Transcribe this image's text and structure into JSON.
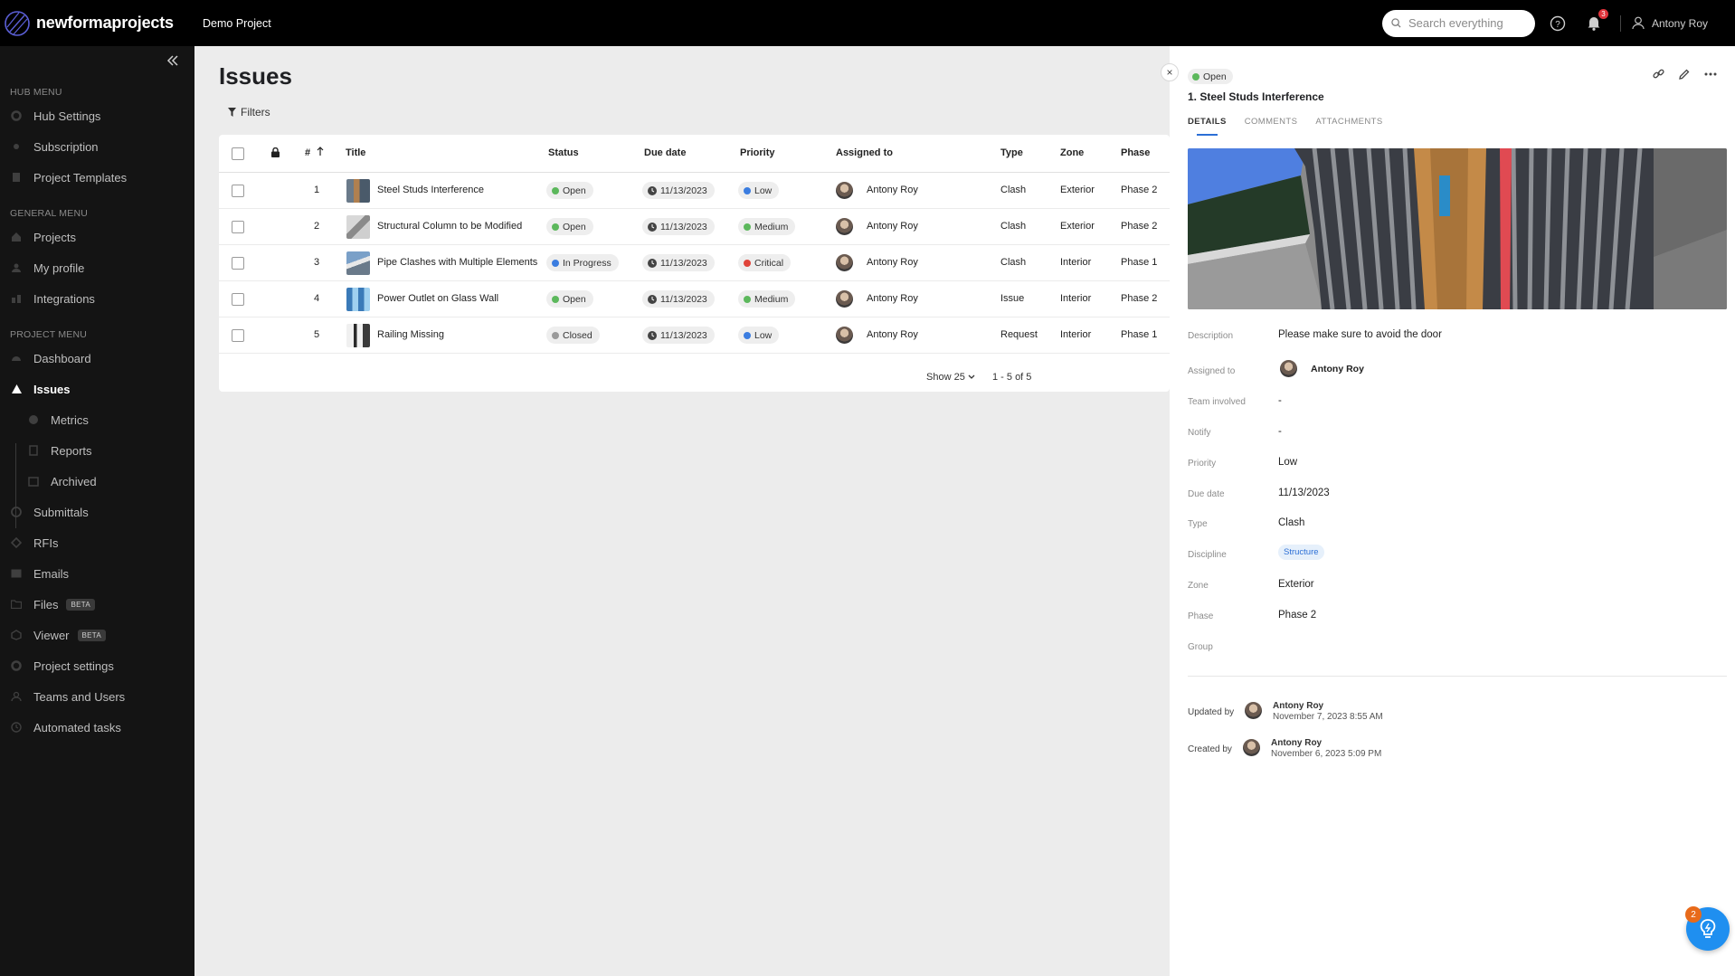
{
  "app": {
    "logo_text": "newformaprojects",
    "project_name": "Demo Project"
  },
  "topbar": {
    "search_placeholder": "Search everything",
    "notification_count": "3",
    "user_name": "Antony Roy"
  },
  "sidebar": {
    "hub_menu_label": "HUB MENU",
    "hub_items": [
      {
        "label": "Hub Settings",
        "icon": "gear-icon"
      },
      {
        "label": "Subscription",
        "icon": "subscription-icon"
      },
      {
        "label": "Project Templates",
        "icon": "template-icon"
      }
    ],
    "general_menu_label": "GENERAL MENU",
    "general_items": [
      {
        "label": "Projects",
        "icon": "home-icon"
      },
      {
        "label": "My profile",
        "icon": "user-icon"
      },
      {
        "label": "Integrations",
        "icon": "integrations-icon"
      }
    ],
    "project_menu_label": "PROJECT MENU",
    "project_items": [
      {
        "label": "Dashboard",
        "icon": "dashboard-icon"
      },
      {
        "label": "Issues",
        "icon": "warning-icon"
      },
      {
        "label": "Metrics",
        "icon": "metrics-icon"
      },
      {
        "label": "Reports",
        "icon": "reports-icon"
      },
      {
        "label": "Archived",
        "icon": "archive-icon"
      },
      {
        "label": "Submittals",
        "icon": "submittals-icon"
      },
      {
        "label": "RFIs",
        "icon": "rfi-icon"
      },
      {
        "label": "Emails",
        "icon": "email-icon"
      },
      {
        "label": "Files",
        "icon": "folder-icon",
        "badge": "BETA"
      },
      {
        "label": "Viewer",
        "icon": "viewer-icon",
        "badge": "BETA"
      },
      {
        "label": "Project settings",
        "icon": "settings-icon"
      },
      {
        "label": "Teams and Users",
        "icon": "team-icon"
      },
      {
        "label": "Automated tasks",
        "icon": "clock-icon"
      }
    ]
  },
  "main": {
    "title": "Issues",
    "filters_label": "Filters",
    "columns": [
      "#",
      "Title",
      "Status",
      "Due date",
      "Priority",
      "Assigned to",
      "Type",
      "Zone",
      "Phase"
    ],
    "rows": [
      {
        "num": "1",
        "title": "Steel Studs Interference",
        "status": "Open",
        "status_color": "#5cb85c",
        "due": "11/13/2023",
        "priority": "Low",
        "priority_color": "#3b7de0",
        "assigned": "Antony Roy",
        "type": "Clash",
        "zone": "Exterior",
        "phase": "Phase 2"
      },
      {
        "num": "2",
        "title": "Structural Column to be Modified",
        "status": "Open",
        "status_color": "#5cb85c",
        "due": "11/13/2023",
        "priority": "Medium",
        "priority_color": "#5cb85c",
        "assigned": "Antony Roy",
        "type": "Clash",
        "zone": "Exterior",
        "phase": "Phase 2"
      },
      {
        "num": "3",
        "title": "Pipe Clashes with Multiple Elements",
        "status": "In Progress",
        "status_color": "#3b7de0",
        "due": "11/13/2023",
        "priority": "Critical",
        "priority_color": "#e0443a",
        "assigned": "Antony Roy",
        "type": "Clash",
        "zone": "Interior",
        "phase": "Phase 1"
      },
      {
        "num": "4",
        "title": "Power Outlet on Glass Wall",
        "status": "Open",
        "status_color": "#5cb85c",
        "due": "11/13/2023",
        "priority": "Medium",
        "priority_color": "#5cb85c",
        "assigned": "Antony Roy",
        "type": "Issue",
        "zone": "Interior",
        "phase": "Phase 2"
      },
      {
        "num": "5",
        "title": "Railing Missing",
        "status": "Closed",
        "status_color": "#9a9a9a",
        "due": "11/13/2023",
        "priority": "Low",
        "priority_color": "#3b7de0",
        "assigned": "Antony Roy",
        "type": "Request",
        "zone": "Interior",
        "phase": "Phase 1"
      }
    ],
    "show_label": "Show 25",
    "range_label": "1 - 5 of 5"
  },
  "detail": {
    "status": "Open",
    "status_color": "#5cb85c",
    "title": "1. Steel Studs Interference",
    "tabs": [
      "DETAILS",
      "COMMENTS",
      "ATTACHMENTS"
    ],
    "fields": {
      "description_label": "Description",
      "description": "Please make sure to avoid the door",
      "assigned_label": "Assigned to",
      "assigned": "Antony Roy",
      "team_label": "Team involved",
      "team": "-",
      "notify_label": "Notify",
      "notify": "-",
      "priority_label": "Priority",
      "priority": "Low",
      "due_label": "Due date",
      "due": "11/13/2023",
      "type_label": "Type",
      "type": "Clash",
      "discipline_label": "Discipline",
      "discipline": "Structure",
      "zone_label": "Zone",
      "zone": "Exterior",
      "phase_label": "Phase",
      "phase": "Phase 2",
      "group_label": "Group"
    },
    "updated_label": "Updated by",
    "updated_name": "Antony Roy",
    "updated_date": "November 7, 2023 8:55 AM",
    "created_label": "Created by",
    "created_name": "Antony Roy",
    "created_date": "November 6, 2023 5:09 PM"
  },
  "help_badge": "2"
}
